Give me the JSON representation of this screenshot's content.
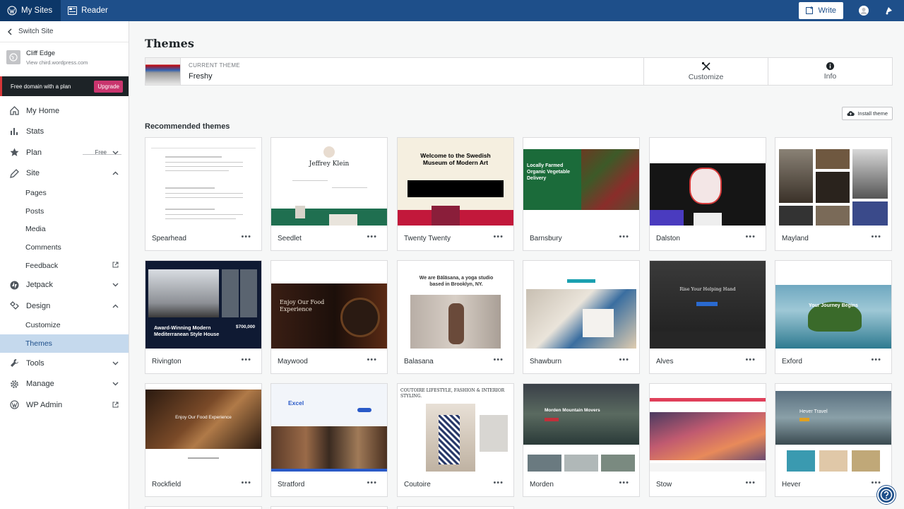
{
  "masterbar": {
    "my_sites": "My Sites",
    "reader": "Reader",
    "write": "Write"
  },
  "sidebar": {
    "switch_site": "Switch Site",
    "site_name": "Cliff Edge",
    "site_url": "View chird.wordpress.com",
    "upsell_text": "Free domain with a plan",
    "upgrade": "Upgrade",
    "my_home": "My Home",
    "stats": "Stats",
    "plan": "Plan",
    "plan_badge": "Free",
    "site": "Site",
    "pages": "Pages",
    "posts": "Posts",
    "media": "Media",
    "comments": "Comments",
    "feedback": "Feedback",
    "jetpack": "Jetpack",
    "design": "Design",
    "customize": "Customize",
    "themes": "Themes",
    "tools": "Tools",
    "manage": "Manage",
    "wp_admin": "WP Admin"
  },
  "main": {
    "title": "Themes",
    "current_label": "CURRENT THEME",
    "current_name": "Freshy",
    "customize": "Customize",
    "info": "Info",
    "install": "Install theme",
    "recommended": "Recommended themes",
    "more": "•••"
  },
  "themes": [
    "Spearhead",
    "Seedlet",
    "Twenty Twenty",
    "Barnsbury",
    "Dalston",
    "Mayland",
    "Rivington",
    "Maywood",
    "Balasana",
    "Shawburn",
    "Alves",
    "Exford",
    "Rockfield",
    "Stratford",
    "Coutoire",
    "Morden",
    "Stow",
    "Hever"
  ],
  "thumbs": {
    "seedlet": "Jeffrey Klein",
    "twenty": "Welcome to the Swedish Museum of Modern Art",
    "barnsbury": "Locally Farmed Organic Vegetable Delivery",
    "rivington": "Award-Winning Modern Mediterranean Style House",
    "rivington_price": "$700,000",
    "maywood": "Enjoy Our Food Experience",
    "balasana": "We are Bālāsana, a yoga studio based in Brooklyn, NY.",
    "alves": "Rise Your Helping Hand",
    "exford": "Your Journey Begins",
    "rockfield": "Enjoy Our Food Experience",
    "stratford": "Excel",
    "coutoire": "COUTOIRE LIFESTYLE, FASHION & INTERIOR STYLING.",
    "morden": "Morden Mountain Movers",
    "hever": "Hever Travel"
  }
}
